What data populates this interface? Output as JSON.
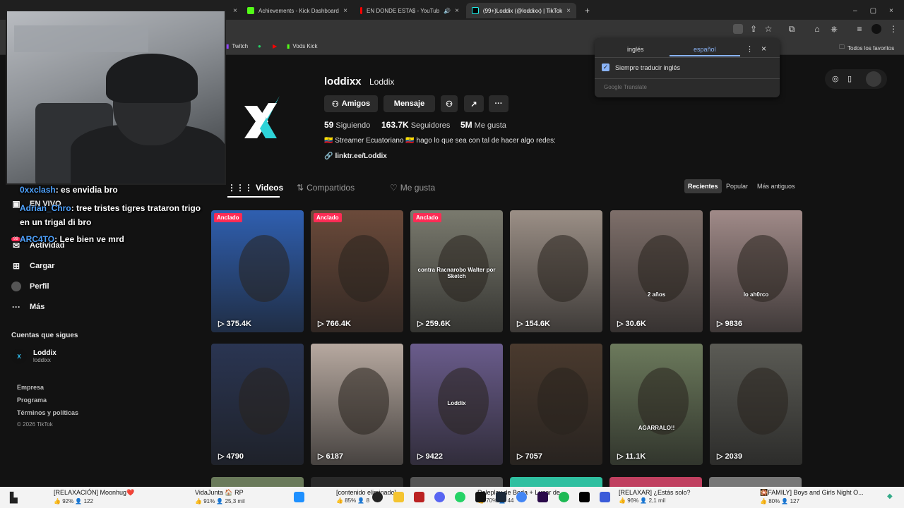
{
  "browser": {
    "tabs": [
      {
        "title": "Achievements - Kick Dashboard",
        "fav_color": "#53fc18",
        "fav_text": "K"
      },
      {
        "title": "EN DONDE ESTA$ - YouTub",
        "fav_color": "#ff0000",
        "fav_text": "▶"
      },
      {
        "title": "(99+)Loddix (@loddixx) | TikTok",
        "fav_color": "#111111",
        "fav_text": "♪"
      }
    ],
    "new_tab": "+",
    "bookmarks": [
      "Twitch",
      "Vods Kick"
    ],
    "all_bookmarks": "Todos los favoritos"
  },
  "translate_popup": {
    "tab_source": "inglés",
    "tab_target": "español",
    "checkbox_label": "Siempre traducir inglés",
    "footer": "Google Translate"
  },
  "chat_overlay": [
    {
      "user": "0xxclash",
      "msg": ": es envidia bro"
    },
    {
      "user": "Adrian_Chro",
      "msg": ": tree tristes tigres trataron trigo"
    },
    {
      "user": "",
      "msg": "en un trigal di bro"
    },
    {
      "user": "ARC4TO",
      "msg": ": Lee bien ve mrd"
    }
  ],
  "sidebar": {
    "items": [
      {
        "label": "EN VIVO",
        "icon": "live-icon"
      },
      {
        "label": "Actividad",
        "icon": "inbox-icon",
        "badge": "99"
      },
      {
        "label": "Cargar",
        "icon": "upload-icon"
      },
      {
        "label": "Perfil",
        "icon": "profile-icon"
      },
      {
        "label": "Más",
        "icon": "more-icon"
      }
    ],
    "following_header": "Cuentas que sigues",
    "following": [
      {
        "name": "Loddix",
        "handle": "loddixx"
      }
    ],
    "footer": [
      "Empresa",
      "Programa",
      "Términos y políticas",
      "© 2026 TikTok"
    ]
  },
  "profile": {
    "username": "loddixx",
    "display_name": "Loddix",
    "buttons": {
      "friends": "Amigos",
      "message": "Mensaje"
    },
    "stats": [
      {
        "value": "59",
        "label": "Siguiendo"
      },
      {
        "value": "163.7K",
        "label": "Seguidores"
      },
      {
        "value": "5M",
        "label": "Me gusta"
      }
    ],
    "bio": "🇪🇨 Streamer Ecuatoriano 🇪🇨 hago lo que sea con tal de hacer algo redes:",
    "link": "linktr.ee/Loddix",
    "tabs": [
      "Videos",
      "Compartidos",
      "Me gusta"
    ],
    "sort": [
      "Recientes",
      "Popular",
      "Más antiguos"
    ]
  },
  "videos": [
    {
      "views": "375.4K",
      "pinned": "Anclado",
      "bg": "#2f5fb0",
      "caption": ""
    },
    {
      "views": "766.4K",
      "pinned": "Anclado",
      "bg": "#6b4a3a",
      "caption": ""
    },
    {
      "views": "259.6K",
      "pinned": "Anclado",
      "bg": "#7a7a6e",
      "caption": "contra Racnarobo Walter por Sketch"
    },
    {
      "views": "154.6K",
      "pinned": "",
      "bg": "#9b8f86",
      "caption": ""
    },
    {
      "views": "30.6K",
      "pinned": "",
      "bg": "#7e6f6a",
      "caption": "2 años"
    },
    {
      "views": "9836",
      "pinned": "",
      "bg": "#a08a88",
      "caption": "lo ah0rco"
    },
    {
      "views": "4790",
      "pinned": "",
      "bg": "#2a3552",
      "caption": ""
    },
    {
      "views": "6187",
      "pinned": "",
      "bg": "#b7a9a0",
      "caption": ""
    },
    {
      "views": "9422",
      "pinned": "",
      "bg": "#6a5c8c",
      "caption": "Loddix"
    },
    {
      "views": "7057",
      "pinned": "",
      "bg": "#4a3a2e",
      "caption": ""
    },
    {
      "views": "11.1K",
      "pinned": "",
      "bg": "#6c7a5c",
      "caption": "AGARRALO!!"
    },
    {
      "views": "2039",
      "pinned": "",
      "bg": "#5b5b55",
      "caption": ""
    }
  ],
  "taskbar": {
    "items": [
      {
        "title": "[RELAXACIÓN] Moonhug❤️",
        "pct": "92%",
        "count": "122"
      },
      {
        "title": "VidaJunta 🏠 RP",
        "pct": "91%",
        "count": "25,3 mil"
      },
      {
        "title": "[contenido eliminado]",
        "pct": "85%",
        "count": "8"
      },
      {
        "title": "Roleplay de Boda + Lugar de...",
        "pct": "70%",
        "count": "44"
      },
      {
        "title": "[RELAXAR] ¿Estás solo?",
        "pct": "96%",
        "count": "2,1 mil"
      },
      {
        "title": "🎇FAMILY] Boys and Girls Night O...",
        "pct": "80%",
        "count": "127"
      }
    ]
  }
}
